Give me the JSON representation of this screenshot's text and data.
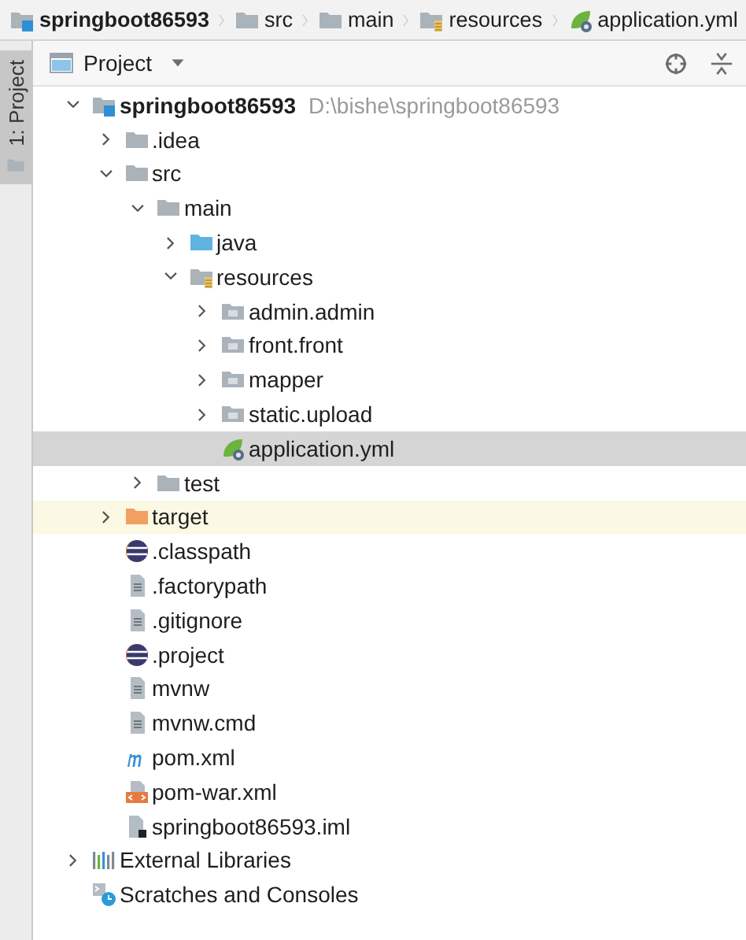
{
  "breadcrumbs": [
    {
      "label": "springboot86593",
      "kind": "module"
    },
    {
      "label": "src",
      "kind": "folder"
    },
    {
      "label": "main",
      "kind": "folder"
    },
    {
      "label": "resources",
      "kind": "resources"
    },
    {
      "label": "application.yml",
      "kind": "spring"
    }
  ],
  "side_tabs": [
    {
      "label": "1: Project",
      "selected": true
    }
  ],
  "panel": {
    "title": "Project"
  },
  "tree": [
    {
      "label": "springboot86593",
      "path": "D:\\bishe\\springboot86593",
      "kind": "module",
      "expanded": true,
      "selected": false,
      "highlighted": false,
      "children": [
        {
          "label": ".idea",
          "kind": "folder",
          "expanded": false,
          "selected": false,
          "highlighted": false
        },
        {
          "label": "src",
          "kind": "folder",
          "expanded": true,
          "selected": false,
          "highlighted": false,
          "children": [
            {
              "label": "main",
              "kind": "folder",
              "expanded": true,
              "selected": false,
              "highlighted": false,
              "children": [
                {
                  "label": "java",
                  "kind": "source",
                  "expanded": false,
                  "selected": false,
                  "highlighted": false
                },
                {
                  "label": "resources",
                  "kind": "resources",
                  "expanded": true,
                  "selected": false,
                  "highlighted": false,
                  "children": [
                    {
                      "label": "admin.admin",
                      "kind": "package",
                      "expanded": false,
                      "selected": false,
                      "highlighted": false
                    },
                    {
                      "label": "front.front",
                      "kind": "package",
                      "expanded": false,
                      "selected": false,
                      "highlighted": false
                    },
                    {
                      "label": "mapper",
                      "kind": "package",
                      "expanded": false,
                      "selected": false,
                      "highlighted": false
                    },
                    {
                      "label": "static.upload",
                      "kind": "package",
                      "expanded": false,
                      "selected": false,
                      "highlighted": false
                    },
                    {
                      "label": "application.yml",
                      "kind": "spring",
                      "selected": true,
                      "highlighted": false
                    }
                  ]
                }
              ]
            },
            {
              "label": "test",
              "kind": "folder",
              "expanded": false,
              "selected": false,
              "highlighted": false
            }
          ]
        },
        {
          "label": "target",
          "kind": "excluded",
          "expanded": false,
          "selected": false,
          "highlighted": true
        },
        {
          "label": ".classpath",
          "kind": "eclipse",
          "selected": false,
          "highlighted": false
        },
        {
          "label": ".factorypath",
          "kind": "text",
          "selected": false,
          "highlighted": false
        },
        {
          "label": ".gitignore",
          "kind": "text",
          "selected": false,
          "highlighted": false
        },
        {
          "label": ".project",
          "kind": "eclipse",
          "selected": false,
          "highlighted": false
        },
        {
          "label": "mvnw",
          "kind": "text",
          "selected": false,
          "highlighted": false
        },
        {
          "label": "mvnw.cmd",
          "kind": "text",
          "selected": false,
          "highlighted": false
        },
        {
          "label": "pom.xml",
          "kind": "maven",
          "selected": false,
          "highlighted": false
        },
        {
          "label": "pom-war.xml",
          "kind": "xml",
          "selected": false,
          "highlighted": false
        },
        {
          "label": "springboot86593.iml",
          "kind": "iml",
          "selected": false,
          "highlighted": false
        }
      ]
    },
    {
      "label": "External Libraries",
      "kind": "libraries",
      "expanded": false,
      "selected": false,
      "highlighted": false
    },
    {
      "label": "Scratches and Consoles",
      "kind": "scratches",
      "selected": false,
      "highlighted": false
    }
  ]
}
